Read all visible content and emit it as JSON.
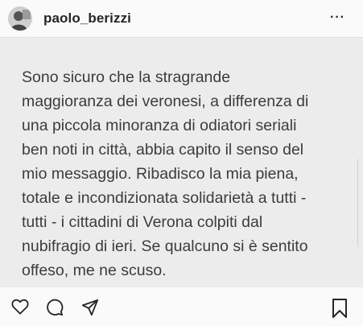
{
  "header": {
    "username": "paolo_berizzi",
    "more_label": "···",
    "avatar_icon": "avatar-photo",
    "more_icon": "more-options-icon"
  },
  "post": {
    "text": "Sono sicuro che la stragrande\nmaggioranza dei veronesi, a differenza di\nuna piccola minoranza di odiatori seriali\nben noti in città, abbia capito il senso del\nmio messaggio. Ribadisco la mia piena,\ntotale e incondizionata solidarietà a tutti -\ntutti - i cittadini di Verona colpiti dal\nnubifragio di ieri. Se qualcuno si è sentito\noffeso, me ne scuso.",
    "background_color": "#ececec"
  },
  "actions": {
    "like_icon": "heart-icon",
    "comment_icon": "comment-icon",
    "share_icon": "share-icon",
    "save_icon": "bookmark-icon"
  }
}
